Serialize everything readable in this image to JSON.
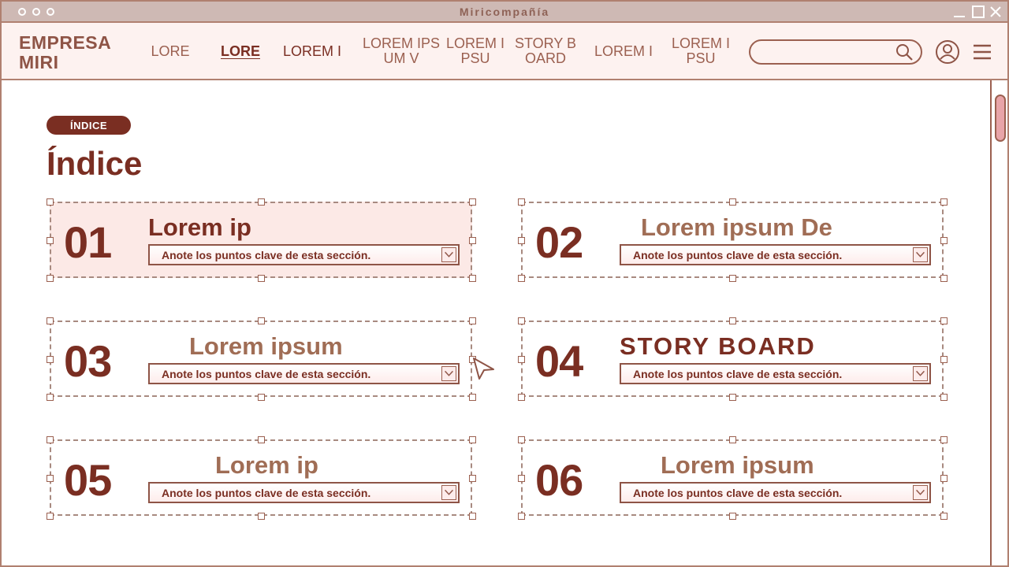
{
  "window": {
    "title": "Miricompañía"
  },
  "navbar": {
    "brand": "EMPRESA\nMIRI",
    "items": [
      {
        "label": "LORE"
      },
      {
        "label": "LORE"
      },
      {
        "label": "LOREM I"
      },
      {
        "label": "LOREM IPS\nUM V"
      },
      {
        "label": "LOREM I\nPSU"
      },
      {
        "label": "STORY B\nOARD"
      },
      {
        "label": "LOREM I"
      },
      {
        "label": "LOREM I\nPSU"
      }
    ],
    "search": {
      "value": "",
      "placeholder": ""
    },
    "icons": [
      "search-icon",
      "user-icon",
      "menu-icon"
    ]
  },
  "page": {
    "badge": "ÍNDICE",
    "title": "Índice"
  },
  "cards": [
    {
      "number": "01",
      "title": "Lorem ip",
      "field": "Anote los puntos clave de esta sección."
    },
    {
      "number": "02",
      "title": "Lorem ipsum De",
      "field": "Anote los puntos clave de esta sección."
    },
    {
      "number": "03",
      "title": "Lorem ipsum",
      "field": "Anote los puntos clave de esta sección."
    },
    {
      "number": "04",
      "title": "STORY BOARD",
      "field": "Anote los puntos clave de esta sección."
    },
    {
      "number": "05",
      "title": "Lorem ip",
      "field": "Anote los puntos clave de esta sección."
    },
    {
      "number": "06",
      "title": "Lorem ipsum",
      "field": "Anote los puntos clave de esta sección."
    }
  ],
  "colors": {
    "accent": "#7a2e22",
    "muted": "#a06d55",
    "highlight": "#fce9e6",
    "border": "#b08070"
  }
}
